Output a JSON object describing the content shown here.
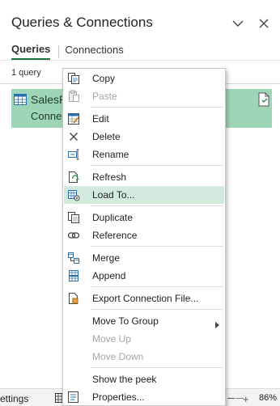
{
  "pane": {
    "title": "Queries & Connections",
    "tabs": [
      "Queries",
      "Connections"
    ],
    "query_count": "1 query"
  },
  "query": {
    "name": "SalesR",
    "status": "Conne"
  },
  "context_menu": {
    "items": [
      {
        "label": "Copy",
        "icon": "copy-icon",
        "disabled": false
      },
      {
        "label": "Paste",
        "icon": "paste-icon",
        "disabled": true
      },
      {
        "label": "Edit",
        "icon": "edit-icon",
        "disabled": false
      },
      {
        "label": "Delete",
        "icon": "delete-icon",
        "disabled": false
      },
      {
        "label": "Rename",
        "icon": "rename-icon",
        "disabled": false
      },
      {
        "label": "Refresh",
        "icon": "refresh-icon",
        "disabled": false
      },
      {
        "label": "Load To...",
        "icon": "load-to-icon",
        "disabled": false,
        "highlighted": true
      },
      {
        "label": "Duplicate",
        "icon": "duplicate-icon",
        "disabled": false
      },
      {
        "label": "Reference",
        "icon": "reference-icon",
        "disabled": false
      },
      {
        "label": "Merge",
        "icon": "merge-icon",
        "disabled": false
      },
      {
        "label": "Append",
        "icon": "append-icon",
        "disabled": false
      },
      {
        "label": "Export Connection File...",
        "icon": "export-icon",
        "disabled": false
      },
      {
        "label": "Move To Group",
        "disabled": false,
        "submenu": true
      },
      {
        "label": "Move Up",
        "disabled": true
      },
      {
        "label": "Move Down",
        "disabled": true
      },
      {
        "label": "Show the peek",
        "disabled": false
      },
      {
        "label": "Properties...",
        "icon": "properties-icon",
        "disabled": false
      }
    ]
  },
  "status_bar": {
    "left_text": "ettings",
    "zoom": "86%"
  },
  "colors": {
    "query_highlight": "#9fd5b7",
    "menu_hover": "#d3ebdd",
    "accent": "#217346"
  }
}
